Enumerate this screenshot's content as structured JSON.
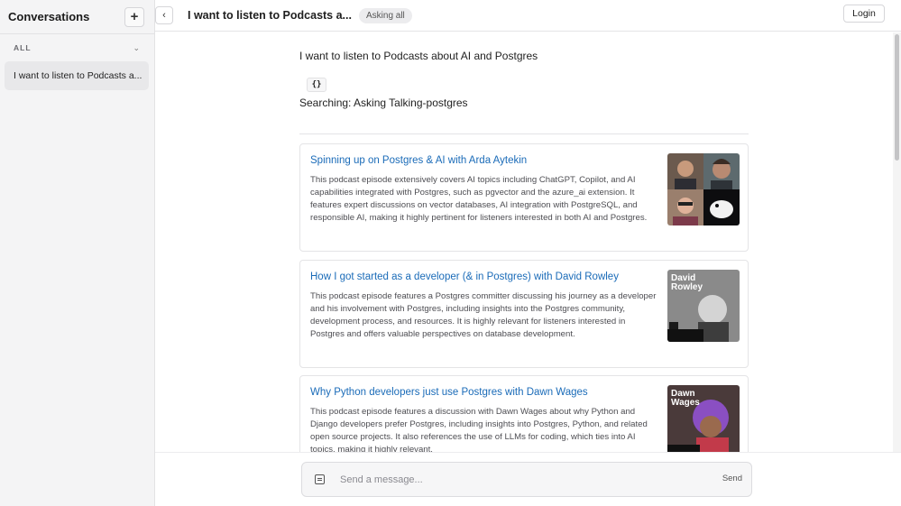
{
  "sidebar": {
    "title": "Conversations",
    "new_label": "+",
    "section_label": "ALL",
    "items": [
      {
        "label": "I want to listen to Podcasts a..."
      }
    ]
  },
  "topbar": {
    "title": "I want to listen to Podcasts a...",
    "badge": "Asking all",
    "login_label": "Login"
  },
  "conversation": {
    "user_message": "I want to listen to Podcasts about AI and Postgres",
    "tool_chip": "{}",
    "status": "Searching: Asking Talking-postgres",
    "results": [
      {
        "title": "Spinning up on Postgres & AI with Arda Aytekin",
        "description": "This podcast episode extensively covers AI topics including ChatGPT, Copilot, and AI capabilities integrated with Postgres, such as pgvector and the azure_ai extension. It features expert discussions on vector databases, AI integration with PostgreSQL, and responsible AI, making it highly pertinent for listeners interested in both AI and Postgres.",
        "thumb_text": ""
      },
      {
        "title": "How I got started as a developer (& in Postgres) with David Rowley",
        "description": "This podcast episode features a Postgres committer discussing his journey as a developer and his involvement with Postgres, including insights into the Postgres community, development process, and resources. It is highly relevant for listeners interested in Postgres and offers valuable perspectives on database development.",
        "thumb_text": "David Rowley"
      },
      {
        "title": "Why Python developers just use Postgres with Dawn Wages",
        "description": "This podcast episode features a discussion with Dawn Wages about why Python and Django developers prefer Postgres, including insights into Postgres, Python, and related open source projects. It also references the use of LLMs for coding, which ties into AI topics, making it highly relevant.",
        "thumb_text": "Dawn Wages"
      }
    ]
  },
  "composer": {
    "placeholder": "Send a message...",
    "send_label": "Send"
  },
  "colors": {
    "link": "#1a6bb8",
    "sidebar_bg": "#f4f4f5"
  }
}
